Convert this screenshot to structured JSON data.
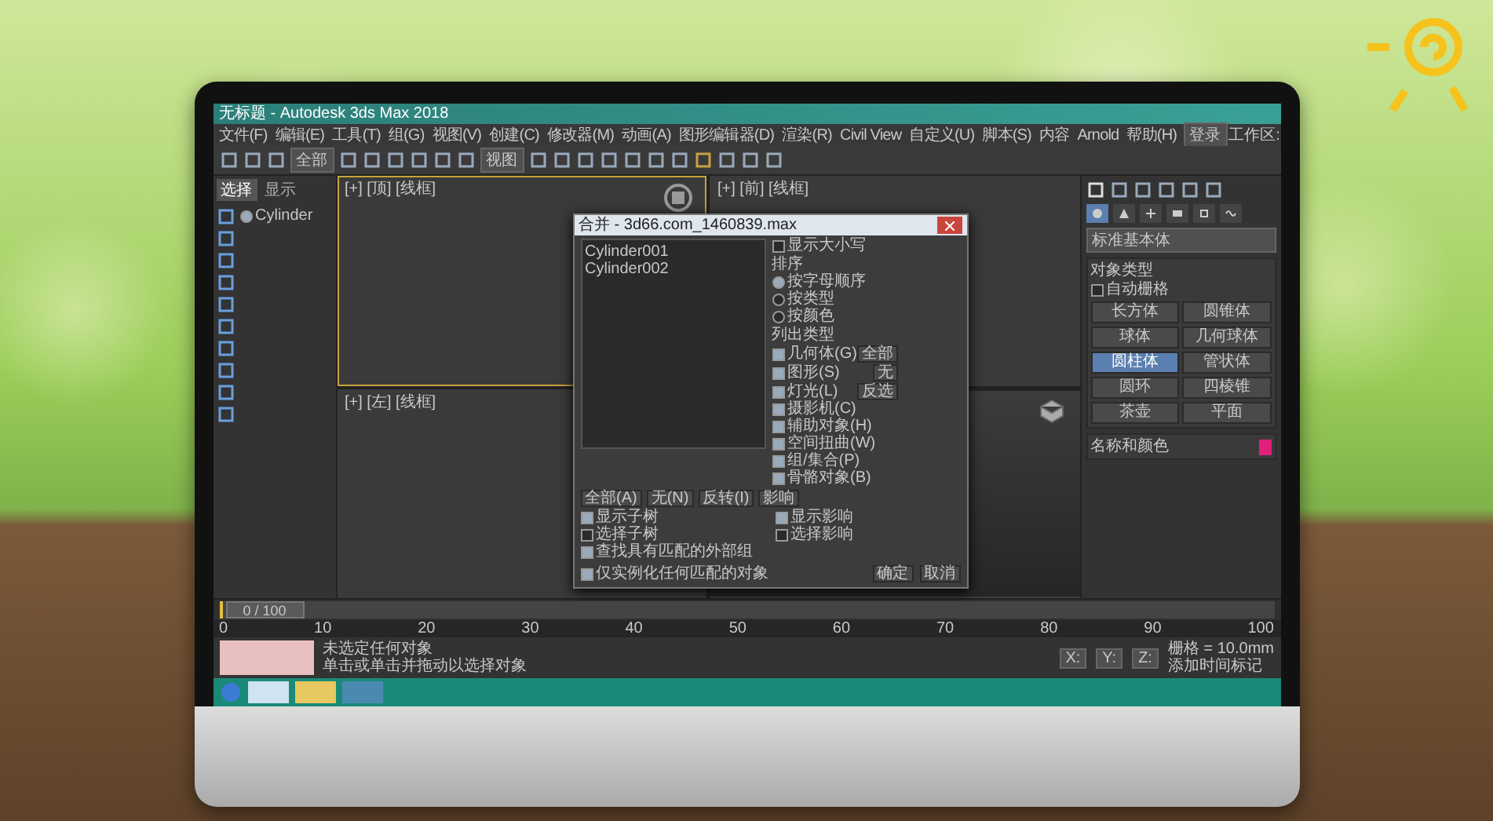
{
  "window": {
    "title": "无标题 - Autodesk 3ds Max 2018"
  },
  "menu": [
    "文件(F)",
    "编辑(E)",
    "工具(T)",
    "组(G)",
    "视图(V)",
    "创建(C)",
    "修改器(M)",
    "动画(A)",
    "图形编辑器(D)",
    "渲染(R)",
    "Civil View",
    "自定义(U)",
    "脚本(S)",
    "内容",
    "Arnold",
    "帮助(H)"
  ],
  "account": {
    "user": "登录",
    "workspace": "工作区:"
  },
  "toolbar": {
    "dropdowns": [
      "全部",
      "视图"
    ]
  },
  "scene_explorer": {
    "tabs": [
      {
        "label": "选择",
        "selected": true
      },
      {
        "label": "显示",
        "selected": false
      }
    ],
    "items": [
      {
        "label": "Cylinder"
      }
    ]
  },
  "viewports": [
    {
      "label": "[+] [顶] [线框]",
      "active": true
    },
    {
      "label": "[+] [前] [线框]",
      "active": false
    },
    {
      "label": "[+] [左] [线框]",
      "active": false
    },
    {
      "active": false
    }
  ],
  "command_panel": {
    "tabs": [
      {
        "kind": "create",
        "selected": true
      },
      {
        "kind": "modify",
        "selected": false
      },
      {
        "kind": "hierarchy",
        "selected": false
      },
      {
        "kind": "motion",
        "selected": false
      },
      {
        "kind": "display",
        "selected": false
      },
      {
        "kind": "utilities",
        "selected": false
      }
    ],
    "category": "标准基本体",
    "section": "对象类型",
    "autogrid": "自动栅格",
    "autogrid_checked": false,
    "buttons": [
      {
        "label": "长方体",
        "selected": false
      },
      {
        "label": "圆锥体",
        "selected": false
      },
      {
        "label": "球体",
        "selected": false
      },
      {
        "label": "几何球体",
        "selected": false
      },
      {
        "label": "圆柱体",
        "selected": true
      },
      {
        "label": "管状体",
        "selected": false
      },
      {
        "label": "圆环",
        "selected": false
      },
      {
        "label": "四棱锥",
        "selected": false
      },
      {
        "label": "茶壶",
        "selected": false
      },
      {
        "label": "平面",
        "selected": false
      }
    ],
    "name_section": "名称和颜色",
    "color": "#e0207a"
  },
  "dialog": {
    "title": "合并 - 3d66.com_1460839.max",
    "list": [
      "Cylinder001",
      "Cylinder002"
    ],
    "sort": {
      "title": "排序",
      "case_label": "显示大小写",
      "case_checked": false,
      "options": [
        {
          "label": "按字母顺序",
          "selected": true
        },
        {
          "label": "按类型",
          "selected": false
        },
        {
          "label": "按颜色",
          "selected": false
        }
      ]
    },
    "types_title": "列出类型",
    "types": [
      {
        "label": "几何体(G)",
        "checked": true
      },
      {
        "label": "图形(S)",
        "checked": true
      },
      {
        "label": "灯光(L)",
        "checked": true
      },
      {
        "label": "摄影机(C)",
        "checked": true
      },
      {
        "label": "辅助对象(H)",
        "checked": true
      },
      {
        "label": "空间扭曲(W)",
        "checked": true
      },
      {
        "label": "组/集合(P)",
        "checked": true
      },
      {
        "label": "骨骼对象(B)",
        "checked": true
      }
    ],
    "type_buttons": [
      "全部",
      "无",
      "反选"
    ],
    "list_buttons": [
      "全部(A)",
      "无(N)",
      "反转(I)",
      "影响"
    ],
    "options": [
      {
        "label": "显示子树",
        "checked": true
      },
      {
        "label": "显示影响",
        "checked": true
      },
      {
        "label": "选择子树",
        "checked": false
      },
      {
        "label": "选择影响",
        "checked": false
      },
      {
        "label": "查找具有匹配的外部组",
        "checked": true
      },
      {
        "label": "仅实例化任何匹配的对象",
        "checked": true
      }
    ],
    "actions": [
      "确定",
      "取消"
    ]
  },
  "timeline": {
    "readout": "0 / 100",
    "level": 0,
    "ticks": [
      "0",
      "10",
      "20",
      "30",
      "40",
      "50",
      "60",
      "70",
      "80",
      "90",
      "100"
    ]
  },
  "status": {
    "message": "未选定任何对象",
    "prompt": "单击或单击并拖动以选择对象",
    "coords": [
      {
        "axis": "X:"
      },
      {
        "axis": "Y:"
      },
      {
        "axis": "Z:"
      }
    ],
    "grid": "栅格 = 10.0mm",
    "time_tag": "添加时间标记"
  }
}
